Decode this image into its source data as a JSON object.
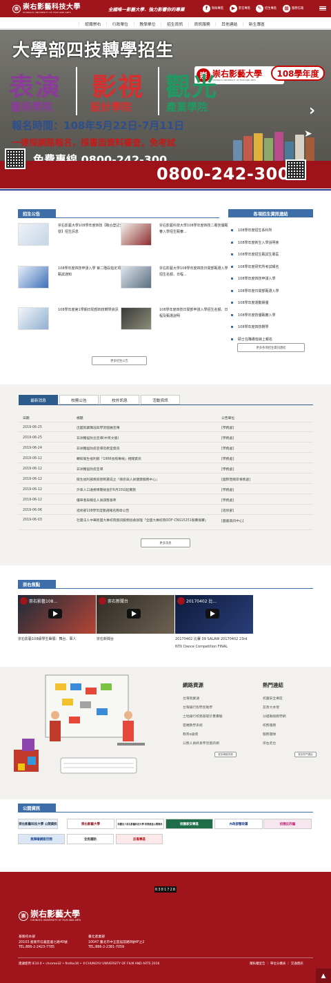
{
  "header": {
    "school_name": "崇右影藝科技大學",
    "school_name_en": "CHUNGYU UNIVERSITY OF FILM AND ARTS",
    "slogan": "全國唯一影藝大學．強力影響你的專業",
    "buttons": [
      {
        "icon": "facebook-icon",
        "label": "粉絲專區"
      },
      {
        "icon": "play-icon",
        "label": "影音專區"
      },
      {
        "icon": "enroll-icon",
        "label": "招生專區"
      },
      {
        "icon": "grid-icon",
        "label": "服務信箱"
      }
    ]
  },
  "nav": {
    "items": [
      "認識崇右",
      "行政單位",
      "教學單位",
      "招生資訊",
      "資訊服務",
      "其他連結",
      "新生專區"
    ]
  },
  "banner": {
    "title": "大學部四技轉學招生",
    "logo_text": "崇右影藝大學",
    "logo_en": "CHUNGYU UNIVERSITY OF FILM AND ARTS",
    "col1_big": "表演",
    "col1_sub": "藝術學院",
    "col2_big": "影視",
    "col2_sub": "設計學院",
    "col3_big": "觀光",
    "col3_sub": "產業學院",
    "badge": "108學年度",
    "reg_time": "報名時間：108年5月22日-7月11日",
    "online": "一律採網路報名，採書面資料審查，免考試",
    "phone_old": "免費專線 0800-242-300",
    "phone": "0800-242-300"
  },
  "admissions": {
    "heading": "招生公告",
    "items": [
      "崇右影藝大學108學年度四技【聯合登記分發】招生訊息",
      "崇右影藝科技大學108學年度四技二專技優甄審入學招生甄審...",
      "108學年度四技申請入學 第二階段指定項目甄試通知",
      "崇右影藝大學108學年度四技日間部甄選入學招生名額、日程...",
      "108學年度第1學期日間部四技轉學資訊",
      "108學年度四技日間部申請入學招生名額、日程及甄選說明"
    ],
    "more": "更多招生公告"
  },
  "links": {
    "heading": "各項招生資訊連結",
    "items": [
      "108學年度招生系科所",
      "108學年度新生入學說明會",
      "108學年度招生甄試生專區",
      "108學年度研究所考試報名",
      "108學年度四技申請入學",
      "108學年度日間部甄選入學",
      "108學年度運動績優",
      "108學年度技優甄審入學",
      "108學年度四技轉學",
      "碩士在職專班線上報名"
    ],
    "more": "更多各項招生資訊連結"
  },
  "news": {
    "tabs": [
      "最新消息",
      "校務公告",
      "校外訊息",
      "活動資訊"
    ],
    "columns": [
      "日期",
      "標題",
      "公告單位"
    ],
    "rows": [
      [
        "2019-06-25",
        "出國就業職涯與學習個展宣傳",
        "[學務處]"
      ],
      [
        "2019-06-25",
        "非洲豬瘟防治宣導(中英文版)",
        "[學務處]"
      ],
      [
        "2019-06-24",
        "非洲豬瘟防疫宣導及教室資訊",
        "[學務處]"
      ],
      [
        "2019-06-12",
        "轉知衛生福利部「1966長照專線」相關資訊",
        "[學務處]"
      ],
      [
        "2019-06-12",
        "非洲豬瘟防疫宣導",
        "[學務處]"
      ],
      [
        "2019-06-12",
        "衛生福利部疾病管制署成立「麻疹與人員健康服務中心」",
        "[國際暨兩岸事務處]"
      ],
      [
        "2019-06-12",
        "外來人口違規導覽檢查於6月20日起實施",
        "[學務處]"
      ],
      [
        "2019-06-12",
        "優單者與報名人員調整基準",
        "[學務處]"
      ],
      [
        "2019-06-06",
        "進修部108學年度甄選報名簡章公告",
        "[進修部]"
      ],
      [
        "2019-06-03",
        "社團法人中華民國大專校院資訊服務協會辦理「全國大專校院ODF-CNS15251競賽競賽」",
        "[圖書資訊中心]"
      ]
    ],
    "more": "更多消息"
  },
  "videos": {
    "heading": "崇右焦點",
    "items": [
      {
        "title": "崇右影藝108...",
        "caption": "崇右影藝108級學生畢展：舞台．軍人"
      },
      {
        "title": "崇右新聞台",
        "caption": "崇右新聞台"
      },
      {
        "title": "20170402 比...",
        "caption": "20170402 比賽 09 SALAW 20170402 23rd NTU Dance Competition FINAL"
      }
    ]
  },
  "resources": {
    "heading": "網路資源",
    "items": [
      "台灣就業通",
      "台灣銀行對學習助學",
      "土地銀行校務基礎計畫實驗",
      "雲端教學系統",
      "教育e論壇",
      "公務人員終身學習資訊網"
    ],
    "more": "更多網路資源"
  },
  "hotlinks": {
    "heading": "熱門連結",
    "items": [
      "校園安全專區",
      "友善大本營",
      "分組聯絡教學網",
      "校務服務",
      "服務團隊",
      "崇右走台"
    ],
    "more": "更多熱門連結"
  },
  "public": {
    "heading": "公開資訊",
    "row1": [
      "崇右影藝科技大學 公開資訊",
      "崇右影藝大學",
      "財團法人崇右影藝科技大學 校務基金公開資訊",
      "校園家安專區",
      "內政部警政署",
      "校園反詐騙"
    ],
    "row2": [
      "無障礙網路空間",
      "全民國防",
      "反毒專區"
    ]
  },
  "footer": {
    "counter": "0301728",
    "school_name": "崇右影藝大學",
    "school_name_en": "CHUNGYU UNIVERSITY OF FILM AND ARTS",
    "campus1": [
      "基隆校本部",
      "20103 基隆市信義區義七路40號",
      "TEL:886-2-2423-7785"
    ],
    "campus2": [
      "臺北產業部",
      "10047 臺北市中正區館前路8號4F之2",
      "TEL:886-2-2381-7059"
    ],
    "copyright": "建議使用 IE10.0 • chrome32 • firefox30 • ©CHUNGYU UNIVERSITY OF FILM AND ARTS 2016",
    "links": "隱私權宣告 ｜ 單位分機表 ｜ 交通資訊"
  },
  "colors": {
    "brand": "#a0141b",
    "section": "#3d6eaa",
    "news_tab": "#2c5b8c"
  }
}
